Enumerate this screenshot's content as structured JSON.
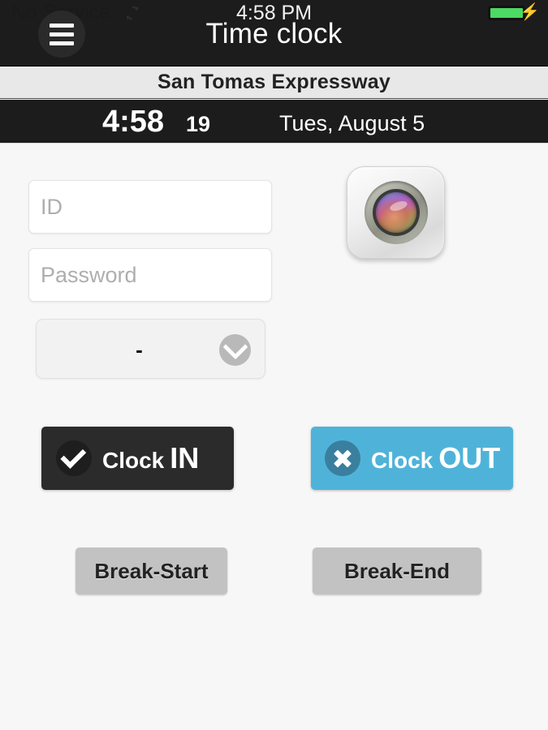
{
  "status_bar": {
    "carrier": "No Service",
    "sync_icon": "sync-icon",
    "time": "4:58 PM",
    "battery_icon": "battery-full-icon",
    "charging_icon": "lightning-bolt-icon"
  },
  "nav_bar": {
    "menu_icon": "hamburger-menu-icon",
    "title": "Time clock"
  },
  "location": {
    "name": "San Tomas Expressway"
  },
  "clock": {
    "time": "4:58",
    "seconds": "19",
    "date": "Tues, August 5"
  },
  "form": {
    "id_placeholder": "ID",
    "id_value": "",
    "password_placeholder": "Password",
    "password_value": "",
    "select_value": "-",
    "select_chevron_icon": "chevron-down-icon",
    "camera_icon": "camera-lens-icon"
  },
  "actions": {
    "clock_in": {
      "icon": "check-circle-icon",
      "label_primary": "Clock",
      "label_emphasis": "IN"
    },
    "clock_out": {
      "icon": "x-circle-icon",
      "label_primary": "Clock",
      "label_emphasis": "OUT"
    },
    "break_start": "Break-Start",
    "break_end": "Break-End"
  },
  "colors": {
    "nav_background": "#1c1c1c",
    "location_background": "#e8e8e8",
    "clock_background": "#1c1c1c",
    "page_background": "#f7f7f7",
    "clock_in_background": "#2b2b2b",
    "clock_out_background": "#4fb3d9",
    "break_background": "#c2c2c2",
    "battery_green": "#4cd964"
  }
}
